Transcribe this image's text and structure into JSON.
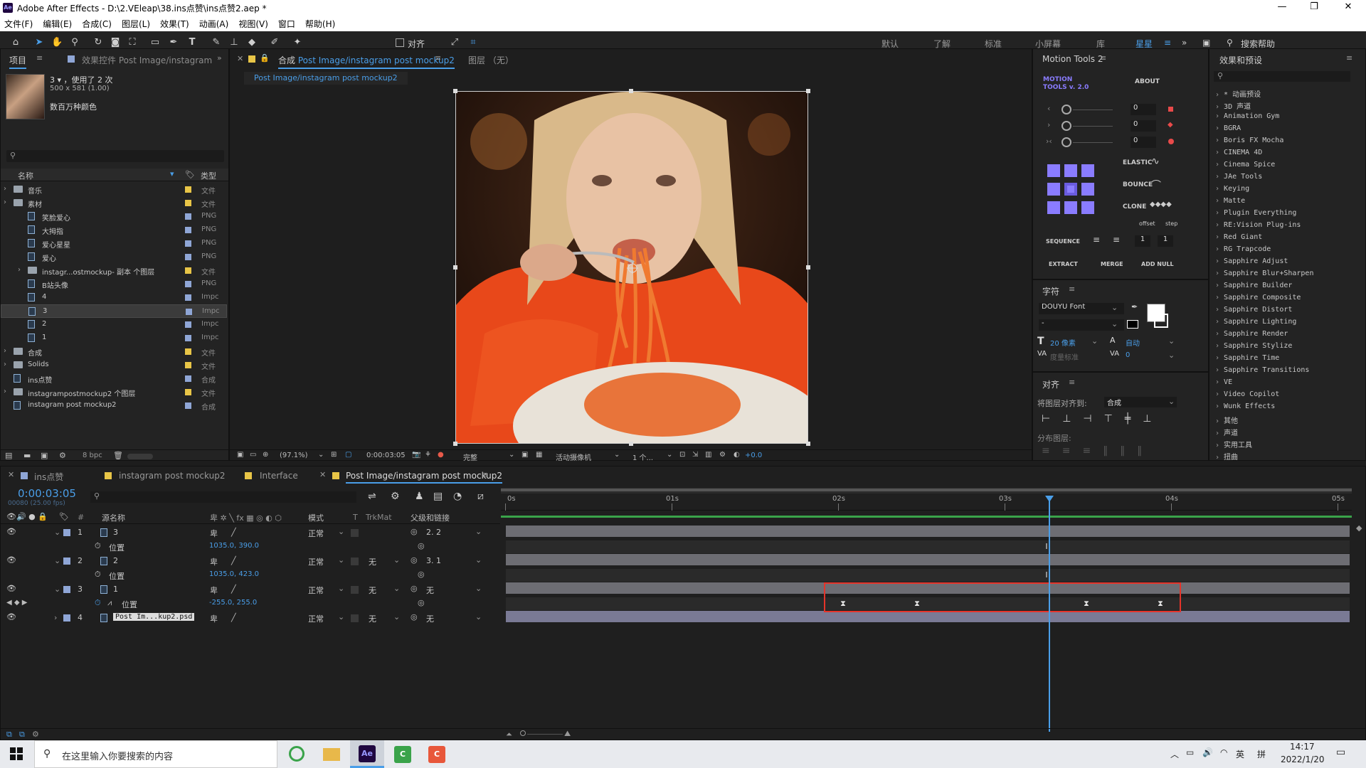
{
  "window": {
    "title": "Adobe After Effects - D:\\2.VEleap\\38.ins点赞\\ins点赞2.aep *",
    "logo": "Ae"
  },
  "menu": [
    "文件(F)",
    "编辑(E)",
    "合成(C)",
    "图层(L)",
    "效果(T)",
    "动画(A)",
    "视图(V)",
    "窗口",
    "帮助(H)"
  ],
  "toolbar": {
    "align_label": "对齐",
    "workspaces": [
      "默认",
      "了解",
      "标准",
      "小屏幕",
      "库",
      "星星"
    ],
    "active_workspace": "星星",
    "search_placeholder": "搜索帮助"
  },
  "project": {
    "tab": "项目",
    "effects_tab": "效果控件 Post Image/instagram",
    "selected": {
      "name": "3",
      "used": "，使用了 2 次",
      "size": "500 x 581 (1.00)",
      "extra": "数百万种颜色"
    },
    "col_name": "名称",
    "col_type": "类型",
    "items": [
      {
        "label": "音乐",
        "indent": 1,
        "kind": "folder",
        "type": "文件",
        "color": "#e8c547"
      },
      {
        "label": "素材",
        "indent": 1,
        "kind": "folder",
        "type": "文件",
        "color": "#e8c547"
      },
      {
        "label": "笑脸爱心",
        "indent": 2,
        "kind": "file",
        "type": "PNG",
        "color": "#8fa6d6"
      },
      {
        "label": "大拇指",
        "indent": 2,
        "kind": "file",
        "type": "PNG",
        "color": "#8fa6d6"
      },
      {
        "label": "爱心星星",
        "indent": 2,
        "kind": "file",
        "type": "PNG",
        "color": "#8fa6d6"
      },
      {
        "label": "爱心",
        "indent": 2,
        "kind": "file",
        "type": "PNG",
        "color": "#8fa6d6"
      },
      {
        "label": "instagr...ostmockup- 副本 个图层",
        "indent": 2,
        "kind": "folder",
        "type": "文件",
        "color": "#e8c547"
      },
      {
        "label": "B站头像",
        "indent": 2,
        "kind": "file",
        "type": "PNG",
        "color": "#8fa6d6"
      },
      {
        "label": "4",
        "indent": 2,
        "kind": "file",
        "type": "Impc",
        "color": "#8fa6d6"
      },
      {
        "label": "3",
        "indent": 2,
        "kind": "file",
        "type": "Impc",
        "color": "#8fa6d6"
      },
      {
        "label": "2",
        "indent": 2,
        "kind": "file",
        "type": "Impc",
        "color": "#8fa6d6"
      },
      {
        "label": "1",
        "indent": 2,
        "kind": "file",
        "type": "Impc",
        "color": "#8fa6d6"
      },
      {
        "label": "合成",
        "indent": 1,
        "kind": "folder",
        "type": "文件",
        "color": "#e8c547"
      },
      {
        "label": "Solids",
        "indent": 1,
        "kind": "folder",
        "type": "文件",
        "color": "#e8c547"
      },
      {
        "label": "ins点赞",
        "indent": 1,
        "kind": "comp",
        "type": "合成",
        "color": "#8fa6d6"
      },
      {
        "label": "instagrampostmockup2 个图层",
        "indent": 1,
        "kind": "folder",
        "type": "文件",
        "color": "#e8c547"
      },
      {
        "label": "instagram post mockup2",
        "indent": 1,
        "kind": "comp",
        "type": "合成",
        "color": "#8fa6d6"
      }
    ],
    "bpc": "8 bpc"
  },
  "composition": {
    "tab_prefix": "合成",
    "tab": "Post Image/instagram post mockup2",
    "layer_tab": "图层 （无）",
    "breadcrumb": "Post Image/instagram post mockup2",
    "zoom": "(97.1%)",
    "timecode": "0:00:03:05",
    "quality": "完整",
    "camera": "活动摄像机",
    "views": "1 个...",
    "exposure": "+0.0"
  },
  "motion_tools": {
    "title": "Motion Tools 2",
    "logo": "MOTION TOOLS v. 2.0",
    "about": "ABOUT",
    "sliders": [
      "0",
      "0",
      "0"
    ],
    "elastic": "ELASTIC",
    "bounce": "BOUNCE",
    "clone": "CLONE",
    "offset": "offset",
    "step": "step",
    "sequence": "SEQUENCE",
    "offset_val": "1",
    "step_val": "1",
    "extract": "EXTRACT",
    "merge": "MERGE",
    "add_null": "ADD NULL"
  },
  "character": {
    "title": "字符",
    "font": "DOUYU Font",
    "style": "-",
    "size": "20 像素",
    "leading": "自动",
    "tracking": "0",
    "kerning": "度量标准"
  },
  "align": {
    "title": "对齐",
    "align_to_label": "将图层对齐到:",
    "align_to": "合成",
    "distribute": "分布图层:"
  },
  "effects": {
    "title": "效果和预设",
    "items": [
      "* 动画预设",
      "3D 声道",
      "Animation Gym",
      "BGRA",
      "Boris FX Mocha",
      "CINEMA 4D",
      "Cinema Spice",
      "JAe Tools",
      "Keying",
      "Matte",
      "Plugin Everything",
      "RE:Vision Plug-ins",
      "Red Giant",
      "RG Trapcode",
      "Sapphire Adjust",
      "Sapphire Blur+Sharpen",
      "Sapphire Builder",
      "Sapphire Composite",
      "Sapphire Distort",
      "Sapphire Lighting",
      "Sapphire Render",
      "Sapphire Stylize",
      "Sapphire Time",
      "Sapphire Transitions",
      "VE",
      "Video Copilot",
      "Wunk Effects",
      "其他",
      "声道",
      "实用工具",
      "扭曲"
    ]
  },
  "timeline": {
    "tabs": [
      "ins点赞",
      "instagram post mockup2",
      "Interface",
      "Post Image/instagram post mockup2"
    ],
    "active_tab": "Post Image/instagram post mockup2",
    "timecode": "0:00:03:05",
    "frame_info": "00080 (25.00 fps)",
    "headers": {
      "source": "源名称",
      "mode": "模式",
      "t": "T",
      "trkmat": "TrkMat",
      "parent": "父级和链接",
      "num": "#"
    },
    "ruler": [
      "0s",
      "01s",
      "02s",
      "03s",
      "04s",
      "05s"
    ],
    "layers": [
      {
        "num": "1",
        "name": "3",
        "mode": "正常",
        "trkmat": "",
        "parent": "2. 2",
        "prop": "位置",
        "prop_val": "1035.0, 390.0"
      },
      {
        "num": "2",
        "name": "2",
        "mode": "正常",
        "trkmat": "无",
        "parent": "3. 1",
        "prop": "位置",
        "prop_val": "1035.0, 423.0"
      },
      {
        "num": "3",
        "name": "1",
        "mode": "正常",
        "trkmat": "无",
        "parent": "无",
        "prop": "位置",
        "prop_val": "-255.0, 255.0"
      },
      {
        "num": "4",
        "name": "Post Im...kup2.psd",
        "mode": "正常",
        "trkmat": "无",
        "parent": "无"
      }
    ]
  },
  "taskbar": {
    "search": "在这里输入你要搜索的内容",
    "time": "14:17",
    "date": "2022/1/20",
    "ime": "英",
    "ime2": "拼"
  },
  "colors": {
    "accent": "#2d8ceb",
    "highlight_box": "#e5342a",
    "playhead": "#4a9ee8",
    "label_swatch": "#e8c547"
  }
}
